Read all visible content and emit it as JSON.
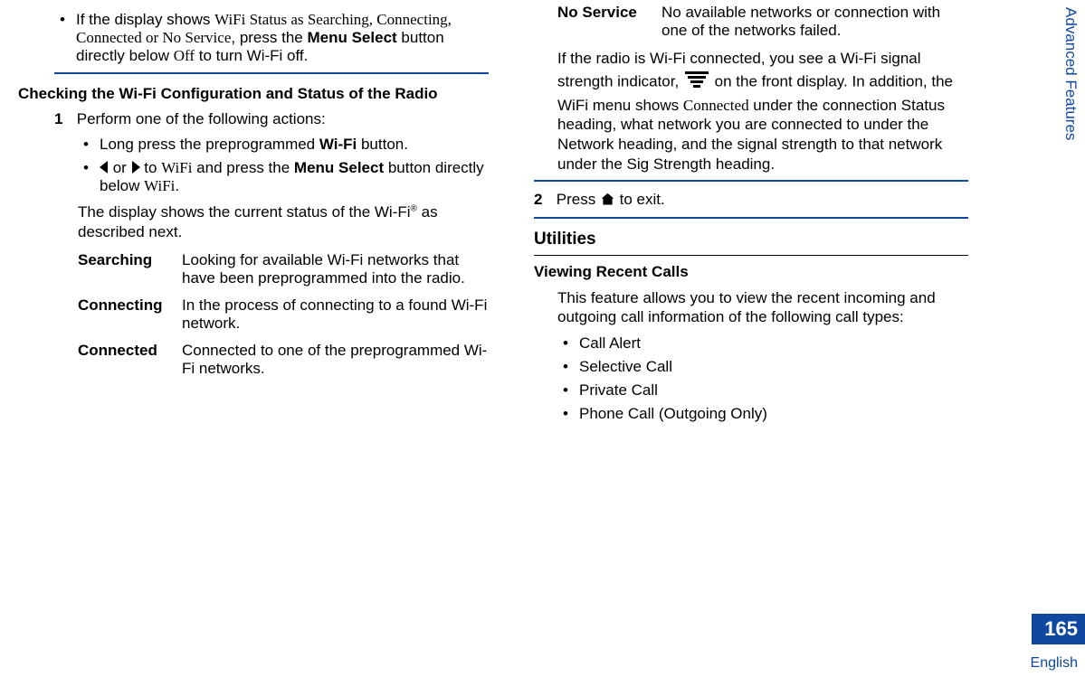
{
  "sideTab": "Advanced Features",
  "pageNumber": "165",
  "language": "English",
  "left": {
    "top_bullet_prefix": "If the display shows ",
    "top_bullet_serif": "WiFi Status as Searching, Connecting, Connected or No Service",
    "top_bullet_mid": ", press the ",
    "top_bullet_bold": "Menu Select",
    "top_bullet_mid2": " button directly below ",
    "top_bullet_serif2": "Off",
    "top_bullet_end": " to turn Wi-Fi off.",
    "heading": "Checking the Wi-Fi Configuration and Status of the Radio",
    "step1_lead": "Perform one of the following actions:",
    "step1_num": "1",
    "sub_bullet1_a": "Long press the preprogrammed ",
    "sub_bullet1_b_bold": "Wi-Fi",
    "sub_bullet1_c": " button.",
    "sub_bullet2_or": " or ",
    "sub_bullet2_to": " to ",
    "sub_bullet2_wifi": "WiFi",
    "sub_bullet2_press": " and press the ",
    "sub_bullet2_ms": "Menu Select",
    "sub_bullet2_below": " button directly below ",
    "sub_bullet2_wifi2": "WiFi",
    "sub_bullet2_dot": ".",
    "para_display_a": "The display shows the current status of the Wi-Fi",
    "para_display_reg": "®",
    "para_display_b": " as described next.",
    "status": [
      {
        "term": "Searching",
        "desc": "Looking for available Wi-Fi networks that have been preprogrammed into the radio."
      },
      {
        "term": "Connecting",
        "desc": "In the process of connecting to a found Wi-Fi network."
      },
      {
        "term": "Connected",
        "desc": "Connected to one of the preprogrammed Wi-Fi networks."
      }
    ]
  },
  "right": {
    "status_no_service": {
      "term": "No Service",
      "desc": "No available networks or connection with one of the networks failed."
    },
    "wifi_para_a": "If the radio is Wi-Fi connected, you see a Wi-Fi signal strength indicator, ",
    "wifi_para_b": " on the front display. In addition, the WiFi menu shows ",
    "wifi_para_serif": "Connected",
    "wifi_para_c": " under the connection Status heading, what network you are connected to under the Network heading, and the signal strength to that network under the Sig Strength heading.",
    "step2_num": "2",
    "step2_a": "Press ",
    "step2_b": " to exit.",
    "utilities_heading": "Utilities",
    "recent_calls_heading": "Viewing Recent Calls",
    "recent_para": "This feature allows you to view the recent incoming and outgoing call information of the following call types:",
    "call_types": [
      "Call Alert",
      "Selective Call",
      "Private Call",
      "Phone Call (Outgoing Only)"
    ]
  }
}
